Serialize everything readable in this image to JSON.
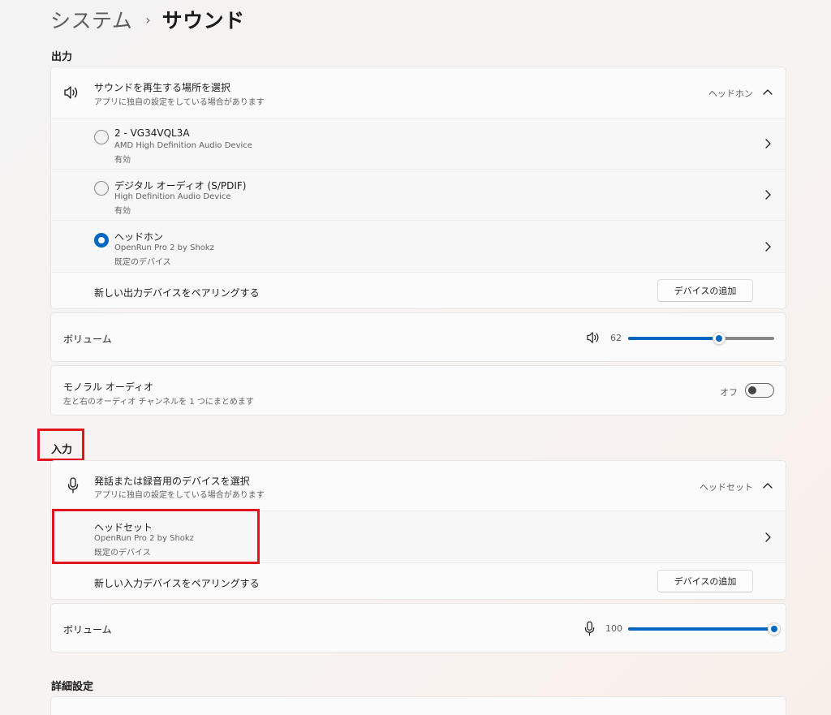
{
  "breadcrumb": {
    "parent": "システム",
    "separator": "›",
    "current": "サウンド"
  },
  "output": {
    "section_title": "出力",
    "selector": {
      "title": "サウンドを再生する場所を選択",
      "subtitle": "アプリに独自の設定をしている場合があります",
      "value": "ヘッドホン",
      "icon": "speaker-icon"
    },
    "devices": [
      {
        "name": "2 - VG34VQL3A",
        "driver": "AMD High Definition Audio Device",
        "status": "有効",
        "selected": false
      },
      {
        "name": "デジタル オーディオ (S/PDIF)",
        "driver": "High Definition Audio Device",
        "status": "有効",
        "selected": false
      },
      {
        "name": "ヘッドホン",
        "driver": "OpenRun Pro 2 by Shokz",
        "status": "既定のデバイス",
        "selected": true
      }
    ],
    "pair": {
      "label": "新しい出力デバイスをペアリングする",
      "button": "デバイスの追加"
    },
    "volume": {
      "label": "ボリューム",
      "value": "62",
      "level": 0.62,
      "icon": "speaker-icon"
    },
    "mono": {
      "title": "モノラル オーディオ",
      "subtitle": "左と右のオーディオ チャンネルを 1 つにまとめます",
      "state": "オフ"
    }
  },
  "input": {
    "section_title": "入力",
    "selector": {
      "title": "発話または録音用のデバイスを選択",
      "subtitle": "アプリに独自の設定をしている場合があります",
      "value": "ヘッドセット",
      "icon": "microphone-icon"
    },
    "devices": [
      {
        "name": "ヘッドセット",
        "driver": "OpenRun Pro 2 by Shokz",
        "status": "既定のデバイス"
      }
    ],
    "pair": {
      "label": "新しい入力デバイスをペアリングする",
      "button": "デバイスの追加"
    },
    "volume": {
      "label": "ボリューム",
      "value": "100",
      "level": 1.0,
      "icon": "microphone-icon"
    }
  },
  "advanced": {
    "section_title": "詳細設定"
  },
  "colors": {
    "accent": "#0067c0",
    "highlight": "#e2141e"
  }
}
